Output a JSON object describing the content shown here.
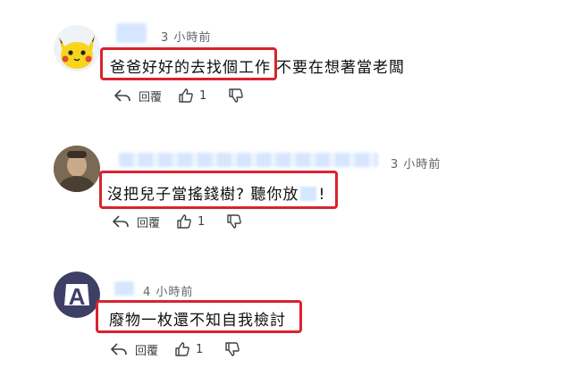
{
  "colors": {
    "highlight": "#d9232e",
    "meta": "#5f6368",
    "text": "#0f0f0f",
    "blur": "#d6e6ff"
  },
  "comments": [
    {
      "time": "3 小時前",
      "text_highlighted": "爸爸好好的去找個工作",
      "text_rest": "不要在想著當老闆",
      "reply_label": "回覆",
      "likes": "1"
    },
    {
      "time": "3 小時前",
      "text_highlighted": "沒把兒子當搖錢樹? 聽你放",
      "text_rest": "!",
      "reply_label": "回覆",
      "likes": "1"
    },
    {
      "time": "4 小時前",
      "text_highlighted": "廢物一枚還不知自我檢討",
      "text_rest": "",
      "reply_label": "回覆",
      "likes": "1"
    }
  ]
}
